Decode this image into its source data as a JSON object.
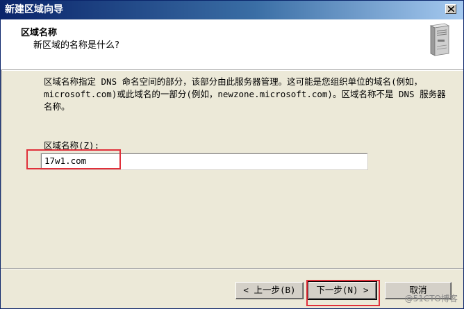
{
  "window": {
    "title": "新建区域向导"
  },
  "header": {
    "title": "区域名称",
    "subtitle": "新区域的名称是什么?"
  },
  "body": {
    "description": "区域名称指定 DNS 命名空间的部分，该部分由此服务器管理。这可能是您组织单位的域名(例如，microsoft.com)或此域名的一部分(例如，newzone.microsoft.com)。区域名称不是 DNS 服务器名称。",
    "field_label": "区域名称(Z):",
    "zone_name_value": "17w1.com"
  },
  "buttons": {
    "back": "< 上一步(B)",
    "next": "下一步(N) >",
    "cancel": "取消"
  },
  "watermark": "@51CTO博客",
  "colors": {
    "highlight": "#e0303a",
    "titlebar_start": "#0a246a",
    "titlebar_end": "#a6caf0"
  }
}
